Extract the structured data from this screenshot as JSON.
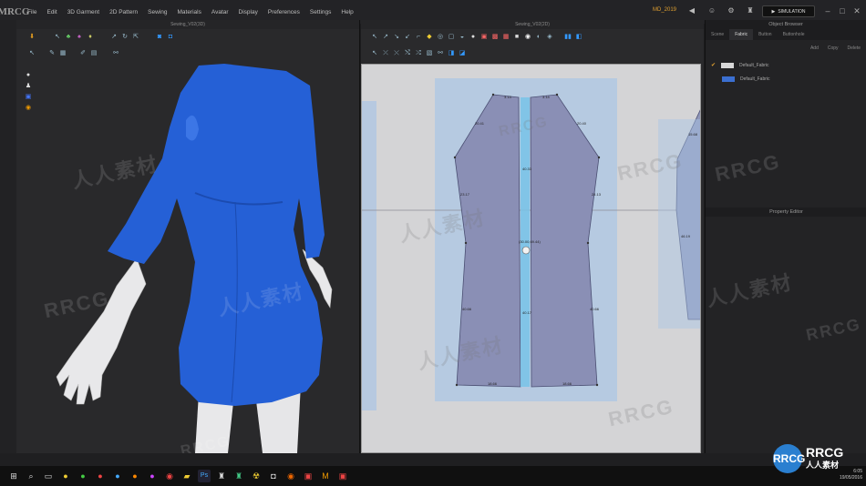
{
  "app": {
    "logo": "MRCG",
    "mode_label": "MD_2019",
    "simulation_label": "SIMULATION"
  },
  "menu": {
    "items": [
      "File",
      "Edit",
      "3D Garment",
      "2D Pattern",
      "Sewing",
      "Materials",
      "Avatar",
      "Display",
      "Preferences",
      "Settings",
      "Help"
    ]
  },
  "view3d": {
    "title": "Sewing_V02(3D)"
  },
  "view2d": {
    "title": "Sewing_V02(2D)",
    "measurements": {
      "top_left": "3.13",
      "top_right": "3.14",
      "shoulder_left": "20.41",
      "shoulder_right": "20.40",
      "side_left": "23.17",
      "side_right": "24.13",
      "center_upper": "40.33",
      "waist_point": "(30.00,69.44)",
      "lower_left": "40.66",
      "lower_right": "40.66",
      "center_lower": "40.17",
      "hem_left": "18.66",
      "hem_right": "18.66",
      "right_piece_top": "15.68",
      "right_piece_side": "46.19"
    }
  },
  "object_browser": {
    "title": "Object Browser",
    "tabs": [
      "Scene",
      "Fabric",
      "Button",
      "Buttonhole"
    ],
    "active_tab": "Fabric",
    "actions": [
      "Add",
      "Copy",
      "Delete"
    ],
    "fabrics": [
      {
        "name": "Default_Fabric",
        "color": "#d8d8d8"
      },
      {
        "name": "Default_Fabric",
        "color": "#3b6fd1"
      }
    ]
  },
  "property_editor": {
    "title": "Property Editor"
  },
  "taskbar": {
    "time": "19/05/2016",
    "clock": "6:05"
  },
  "watermark": {
    "brand": "RRCG",
    "cn": "人人素材"
  }
}
